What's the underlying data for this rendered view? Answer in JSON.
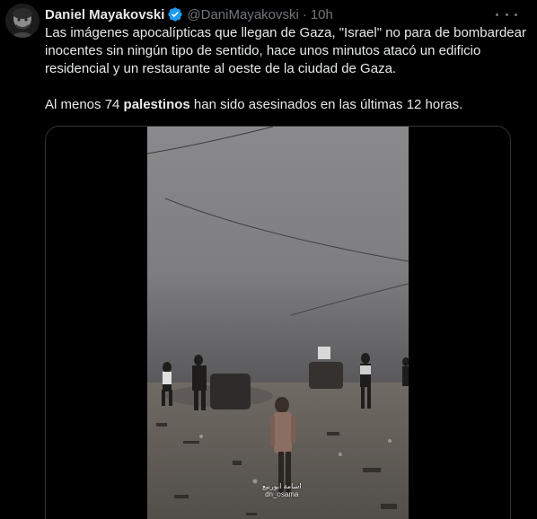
{
  "tweet": {
    "author_name": "Daniel Mayakovski",
    "author_handle": "@DaniMayakovski",
    "separator": "·",
    "time": "10h",
    "body_line1": "Las imágenes apocalípticas que llegan de Gaza, \"Israel\" no para de bombardear inocentes sin ningún tipo de sentido, hace unos minutos atacó un edificio residencial y un restaurante al oeste de la ciudad de Gaza.",
    "body_line2_pre": "Al menos 74 ",
    "body_line2_bold": "palestinos",
    "body_line2_post": " han sido asesinados en las últimas 12 horas."
  },
  "media": {
    "watermark_line1": "اسامة ابوربيع",
    "watermark_line2": "dn_osama"
  },
  "icons": {
    "verified": "verified-badge-icon",
    "more": "more-options-icon",
    "avatar": "avatar"
  },
  "colors": {
    "background": "#000000",
    "text_primary": "#e7e9ea",
    "text_secondary": "#71767b",
    "verified_blue": "#1d9bf0",
    "border": "#2f3336"
  }
}
